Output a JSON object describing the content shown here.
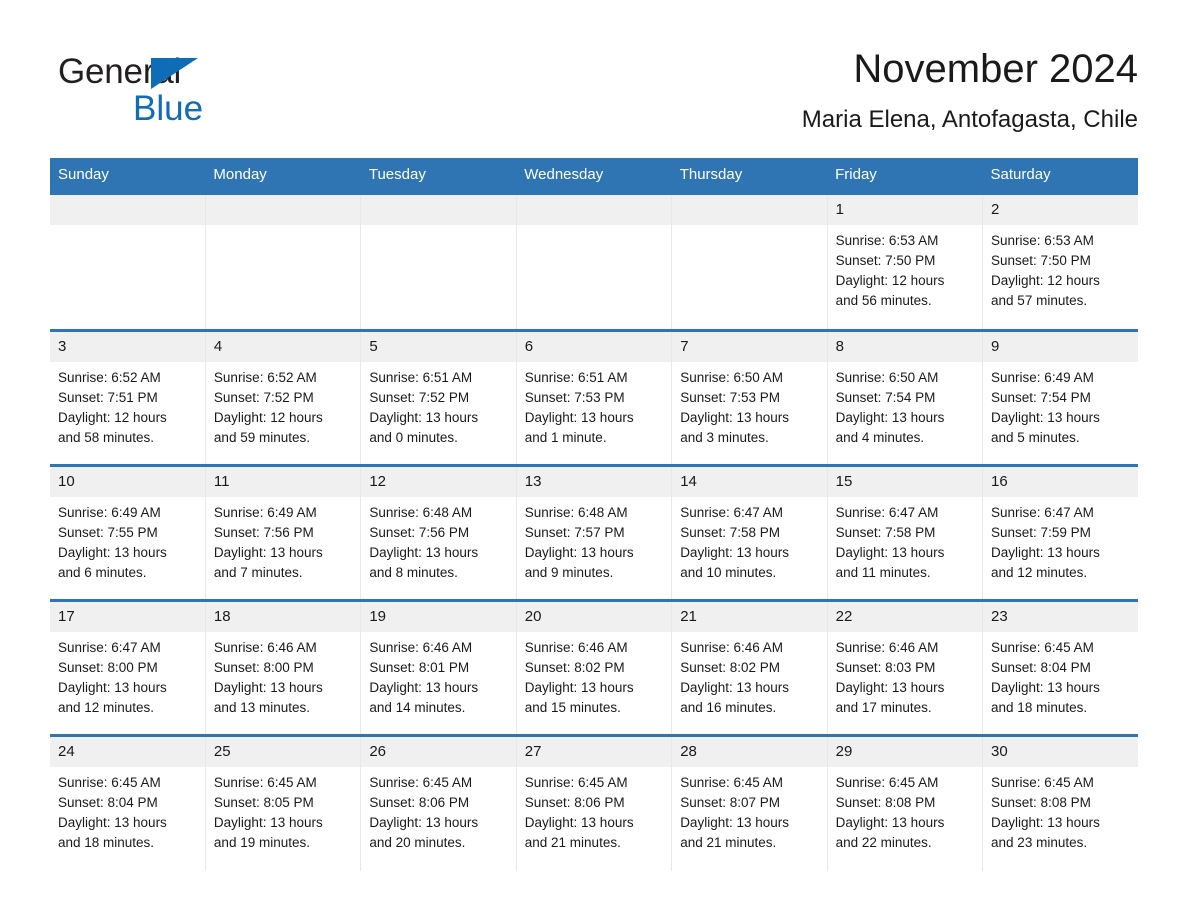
{
  "brand": {
    "name_part1": "General",
    "name_part2": "Blue",
    "triangle_color": "#0f6cb6",
    "text_color": "#231f20"
  },
  "header": {
    "title": "November 2024",
    "subtitle": "Maria Elena, Antofagasta, Chile"
  },
  "colors": {
    "header_blue": "#2f74b3",
    "row_divider_blue": "#2f74b3",
    "daynum_bg": "#f0f0f0",
    "cell_bg": "#ffffff",
    "text": "#1a1a1a"
  },
  "weekday_headers": [
    "Sunday",
    "Monday",
    "Tuesday",
    "Wednesday",
    "Thursday",
    "Friday",
    "Saturday"
  ],
  "labels": {
    "sunrise_prefix": "Sunrise:",
    "sunset_prefix": "Sunset:",
    "daylight_prefix": "Daylight:"
  },
  "weeks": [
    [
      {
        "blank": true
      },
      {
        "blank": true
      },
      {
        "blank": true
      },
      {
        "blank": true
      },
      {
        "blank": true
      },
      {
        "day": "1",
        "sunrise": "Sunrise: 6:53 AM",
        "sunset": "Sunset: 7:50 PM",
        "daylight_line1": "Daylight: 12 hours",
        "daylight_line2": "and 56 minutes."
      },
      {
        "day": "2",
        "sunrise": "Sunrise: 6:53 AM",
        "sunset": "Sunset: 7:50 PM",
        "daylight_line1": "Daylight: 12 hours",
        "daylight_line2": "and 57 minutes."
      }
    ],
    [
      {
        "day": "3",
        "sunrise": "Sunrise: 6:52 AM",
        "sunset": "Sunset: 7:51 PM",
        "daylight_line1": "Daylight: 12 hours",
        "daylight_line2": "and 58 minutes."
      },
      {
        "day": "4",
        "sunrise": "Sunrise: 6:52 AM",
        "sunset": "Sunset: 7:52 PM",
        "daylight_line1": "Daylight: 12 hours",
        "daylight_line2": "and 59 minutes."
      },
      {
        "day": "5",
        "sunrise": "Sunrise: 6:51 AM",
        "sunset": "Sunset: 7:52 PM",
        "daylight_line1": "Daylight: 13 hours",
        "daylight_line2": "and 0 minutes."
      },
      {
        "day": "6",
        "sunrise": "Sunrise: 6:51 AM",
        "sunset": "Sunset: 7:53 PM",
        "daylight_line1": "Daylight: 13 hours",
        "daylight_line2": "and 1 minute."
      },
      {
        "day": "7",
        "sunrise": "Sunrise: 6:50 AM",
        "sunset": "Sunset: 7:53 PM",
        "daylight_line1": "Daylight: 13 hours",
        "daylight_line2": "and 3 minutes."
      },
      {
        "day": "8",
        "sunrise": "Sunrise: 6:50 AM",
        "sunset": "Sunset: 7:54 PM",
        "daylight_line1": "Daylight: 13 hours",
        "daylight_line2": "and 4 minutes."
      },
      {
        "day": "9",
        "sunrise": "Sunrise: 6:49 AM",
        "sunset": "Sunset: 7:54 PM",
        "daylight_line1": "Daylight: 13 hours",
        "daylight_line2": "and 5 minutes."
      }
    ],
    [
      {
        "day": "10",
        "sunrise": "Sunrise: 6:49 AM",
        "sunset": "Sunset: 7:55 PM",
        "daylight_line1": "Daylight: 13 hours",
        "daylight_line2": "and 6 minutes."
      },
      {
        "day": "11",
        "sunrise": "Sunrise: 6:49 AM",
        "sunset": "Sunset: 7:56 PM",
        "daylight_line1": "Daylight: 13 hours",
        "daylight_line2": "and 7 minutes."
      },
      {
        "day": "12",
        "sunrise": "Sunrise: 6:48 AM",
        "sunset": "Sunset: 7:56 PM",
        "daylight_line1": "Daylight: 13 hours",
        "daylight_line2": "and 8 minutes."
      },
      {
        "day": "13",
        "sunrise": "Sunrise: 6:48 AM",
        "sunset": "Sunset: 7:57 PM",
        "daylight_line1": "Daylight: 13 hours",
        "daylight_line2": "and 9 minutes."
      },
      {
        "day": "14",
        "sunrise": "Sunrise: 6:47 AM",
        "sunset": "Sunset: 7:58 PM",
        "daylight_line1": "Daylight: 13 hours",
        "daylight_line2": "and 10 minutes."
      },
      {
        "day": "15",
        "sunrise": "Sunrise: 6:47 AM",
        "sunset": "Sunset: 7:58 PM",
        "daylight_line1": "Daylight: 13 hours",
        "daylight_line2": "and 11 minutes."
      },
      {
        "day": "16",
        "sunrise": "Sunrise: 6:47 AM",
        "sunset": "Sunset: 7:59 PM",
        "daylight_line1": "Daylight: 13 hours",
        "daylight_line2": "and 12 minutes."
      }
    ],
    [
      {
        "day": "17",
        "sunrise": "Sunrise: 6:47 AM",
        "sunset": "Sunset: 8:00 PM",
        "daylight_line1": "Daylight: 13 hours",
        "daylight_line2": "and 12 minutes."
      },
      {
        "day": "18",
        "sunrise": "Sunrise: 6:46 AM",
        "sunset": "Sunset: 8:00 PM",
        "daylight_line1": "Daylight: 13 hours",
        "daylight_line2": "and 13 minutes."
      },
      {
        "day": "19",
        "sunrise": "Sunrise: 6:46 AM",
        "sunset": "Sunset: 8:01 PM",
        "daylight_line1": "Daylight: 13 hours",
        "daylight_line2": "and 14 minutes."
      },
      {
        "day": "20",
        "sunrise": "Sunrise: 6:46 AM",
        "sunset": "Sunset: 8:02 PM",
        "daylight_line1": "Daylight: 13 hours",
        "daylight_line2": "and 15 minutes."
      },
      {
        "day": "21",
        "sunrise": "Sunrise: 6:46 AM",
        "sunset": "Sunset: 8:02 PM",
        "daylight_line1": "Daylight: 13 hours",
        "daylight_line2": "and 16 minutes."
      },
      {
        "day": "22",
        "sunrise": "Sunrise: 6:46 AM",
        "sunset": "Sunset: 8:03 PM",
        "daylight_line1": "Daylight: 13 hours",
        "daylight_line2": "and 17 minutes."
      },
      {
        "day": "23",
        "sunrise": "Sunrise: 6:45 AM",
        "sunset": "Sunset: 8:04 PM",
        "daylight_line1": "Daylight: 13 hours",
        "daylight_line2": "and 18 minutes."
      }
    ],
    [
      {
        "day": "24",
        "sunrise": "Sunrise: 6:45 AM",
        "sunset": "Sunset: 8:04 PM",
        "daylight_line1": "Daylight: 13 hours",
        "daylight_line2": "and 18 minutes."
      },
      {
        "day": "25",
        "sunrise": "Sunrise: 6:45 AM",
        "sunset": "Sunset: 8:05 PM",
        "daylight_line1": "Daylight: 13 hours",
        "daylight_line2": "and 19 minutes."
      },
      {
        "day": "26",
        "sunrise": "Sunrise: 6:45 AM",
        "sunset": "Sunset: 8:06 PM",
        "daylight_line1": "Daylight: 13 hours",
        "daylight_line2": "and 20 minutes."
      },
      {
        "day": "27",
        "sunrise": "Sunrise: 6:45 AM",
        "sunset": "Sunset: 8:06 PM",
        "daylight_line1": "Daylight: 13 hours",
        "daylight_line2": "and 21 minutes."
      },
      {
        "day": "28",
        "sunrise": "Sunrise: 6:45 AM",
        "sunset": "Sunset: 8:07 PM",
        "daylight_line1": "Daylight: 13 hours",
        "daylight_line2": "and 21 minutes."
      },
      {
        "day": "29",
        "sunrise": "Sunrise: 6:45 AM",
        "sunset": "Sunset: 8:08 PM",
        "daylight_line1": "Daylight: 13 hours",
        "daylight_line2": "and 22 minutes."
      },
      {
        "day": "30",
        "sunrise": "Sunrise: 6:45 AM",
        "sunset": "Sunset: 8:08 PM",
        "daylight_line1": "Daylight: 13 hours",
        "daylight_line2": "and 23 minutes."
      }
    ]
  ]
}
